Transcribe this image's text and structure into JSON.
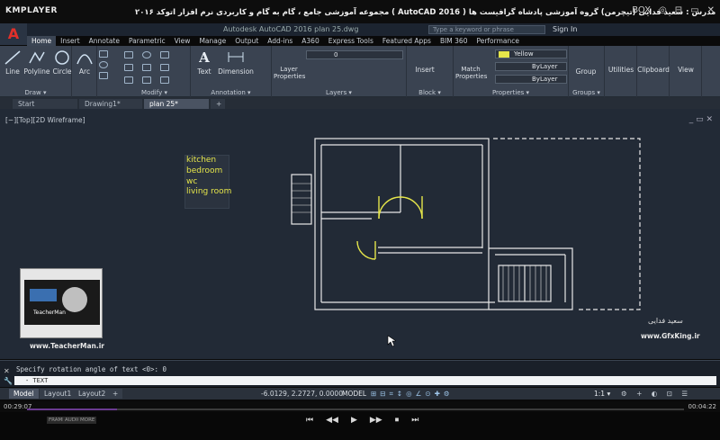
{
  "player": {
    "logo": "KMPLAYER",
    "title": "مجموعه آموزشی جامع ، گام به گام و کاربردی نرم افزار اتوکد ۲۰۱۶ ( AutoCAD 2016 ) مدرس : سعید فدایی (تیچرمن) گروه آموزشی پادشاه گرافیست ها",
    "controls": [
      "BOX",
      "◎",
      "⊟",
      "▭",
      "✕"
    ],
    "time_current": "00:29:07",
    "time_total": "00:04:22",
    "chips": [
      "FRAMES",
      "AUDIO",
      "MORE"
    ],
    "transport": [
      "⏮",
      "◀◀",
      "▶",
      "▶▶",
      "⏹",
      "⏭"
    ]
  },
  "autocad": {
    "doc_title": "Autodesk AutoCAD 2016   plan 25.dwg",
    "search_placeholder": "Type a keyword or phrase",
    "signin": "Sign In",
    "ribbon_tabs": [
      "Home",
      "Insert",
      "Annotate",
      "Parametric",
      "View",
      "Manage",
      "Output",
      "Add-ins",
      "A360",
      "Express Tools",
      "Featured Apps",
      "BIM 360",
      "Performance"
    ],
    "draw_tools": [
      "Line",
      "Polyline",
      "Circle",
      "Arc"
    ],
    "draw_label": "Draw ▾",
    "modify_label": "Modify ▾",
    "annotation_tools": [
      "Text",
      "Dimension"
    ],
    "annotation_label": "Annotation ▾",
    "layers_tool": "Layer Properties",
    "layers_value": "0",
    "layers_label": "Layers ▾",
    "insert_tool": "Insert",
    "block_label": "Block ▾",
    "match_tool": "Match Properties",
    "color_value": "Yellow",
    "linetype_value": "ByLayer",
    "lineweight_value": "ByLayer",
    "properties_label": "Properties ▾",
    "group_tool": "Group",
    "groups_label": "Groups ▾",
    "utilities_tool": "Utilities",
    "clipboard_tool": "Clipboard",
    "view_tool": "View",
    "doc_tabs": [
      "Start",
      "Drawing1*",
      "plan 25*",
      "+"
    ],
    "active_doc_tab": 2,
    "viewport_label": "[−][Top][2D Wireframe]",
    "viewport_controls": "_ ▭ ✕",
    "legend": [
      "kitchen",
      "bedroom",
      "wc",
      "living room"
    ],
    "command_history": "Specify rotation angle of text <0>: 0",
    "command_input": "- TEXT",
    "layout_tabs": [
      "Model",
      "Layout1",
      "Layout2",
      "+"
    ],
    "coordinates": "-6.0129, 2.2727, 0.0000",
    "model_button": "MODEL",
    "scale": "1:1 ▾",
    "colors": {
      "accent": "#e0302a",
      "text_yellow": "#e5e54a",
      "background": "#222a36"
    }
  },
  "watermarks": {
    "teacher_site": "www.TeacherMan.ir",
    "teacher_caption": "TeacherMan",
    "author_name": "سعید فدایی",
    "gfx_site": "www.GfxKing.ir"
  }
}
